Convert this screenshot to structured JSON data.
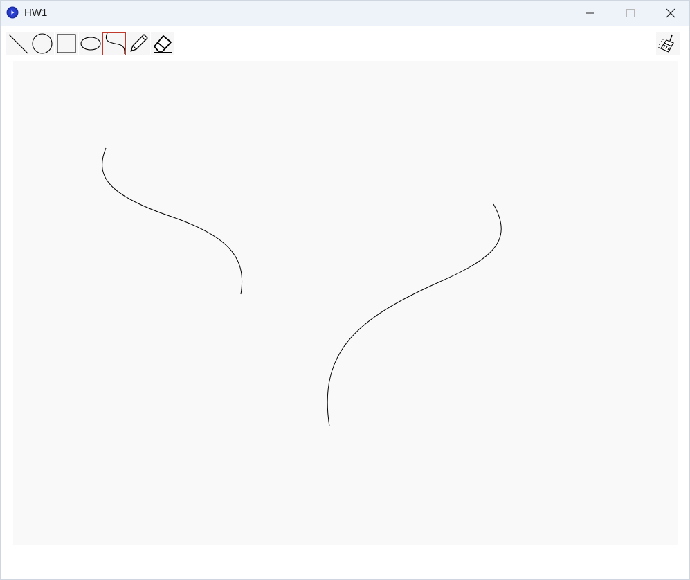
{
  "window": {
    "title": "HW1",
    "app_icon": "app-circle-icon"
  },
  "controls": {
    "minimize_icon": "minimize-icon",
    "maximize_icon": "maximize-icon",
    "close_icon": "close-icon"
  },
  "toolbar": {
    "tools": [
      {
        "name": "line-tool",
        "icon": "line-icon",
        "selected": false
      },
      {
        "name": "circle-tool",
        "icon": "circle-icon",
        "selected": false
      },
      {
        "name": "rectangle-tool",
        "icon": "rectangle-icon",
        "selected": false
      },
      {
        "name": "ellipse-tool",
        "icon": "ellipse-icon",
        "selected": false
      },
      {
        "name": "curve-tool",
        "icon": "bezier-curve-icon",
        "selected": true
      },
      {
        "name": "pencil-tool",
        "icon": "pencil-icon",
        "selected": false
      },
      {
        "name": "eraser-tool",
        "icon": "eraser-icon",
        "selected": false
      }
    ],
    "clear_tool": {
      "name": "clear-canvas-tool",
      "icon": "broom-icon"
    },
    "selected_color": "#c0392b"
  },
  "canvas": {
    "background": "#f9f9f9",
    "stroke_color": "#000000",
    "shape_count": 2
  }
}
